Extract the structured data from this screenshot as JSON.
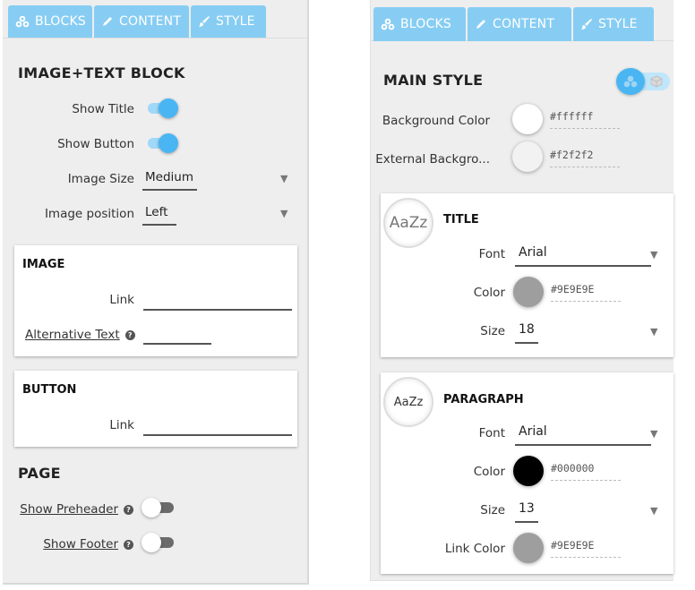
{
  "tabs": [
    {
      "icon": "cubes-icon",
      "label": "BLOCKS"
    },
    {
      "icon": "pencil-icon",
      "label": "CONTENT"
    },
    {
      "icon": "brush-icon",
      "label": "STYLE"
    }
  ],
  "left": {
    "title": "IMAGE+TEXT BLOCK",
    "show_title": {
      "label": "Show Title",
      "on": true
    },
    "show_button": {
      "label": "Show Button",
      "on": true
    },
    "image_size": {
      "label": "Image Size",
      "value": "Medium"
    },
    "image_position": {
      "label": "Image position",
      "value": "Left"
    },
    "image_card": {
      "title": "IMAGE",
      "link_label": "Link",
      "link_value": "",
      "alt_label": "Alternative Text",
      "alt_value": ""
    },
    "button_card": {
      "title": "BUTTON",
      "link_label": "Link",
      "link_value": ""
    },
    "page": {
      "title": "PAGE",
      "show_preheader": {
        "label": "Show Preheader",
        "on": false
      },
      "show_footer": {
        "label": "Show Footer",
        "on": false
      }
    }
  },
  "right": {
    "title": "MAIN STYLE",
    "background_color": {
      "label": "Background Color",
      "value": "#ffffff",
      "swatch": "#ffffff"
    },
    "external_background": {
      "label": "External Backgro...",
      "value": "#f2f2f2",
      "swatch": "#f2f2f2"
    },
    "title_card": {
      "preview": "AaZz",
      "title": "TITLE",
      "font_label": "Font",
      "font_value": "Arial",
      "color_label": "Color",
      "color_value": "#9E9E9E",
      "color_swatch": "#9e9e9e",
      "size_label": "Size",
      "size_value": "18"
    },
    "paragraph_card": {
      "preview": "AaZz",
      "title": "PARAGRAPH",
      "font_label": "Font",
      "font_value": "Arial",
      "color_label": "Color",
      "color_value": "#000000",
      "color_swatch": "#000000",
      "size_label": "Size",
      "size_value": "13",
      "link_color_label": "Link Color",
      "link_color_value": "#9E9E9E",
      "link_color_swatch": "#9e9e9e"
    }
  },
  "colors": {
    "tab_bg": "#87cdf3",
    "toggle_on": "#49b6f3",
    "panel_bg": "#eeeeee"
  }
}
